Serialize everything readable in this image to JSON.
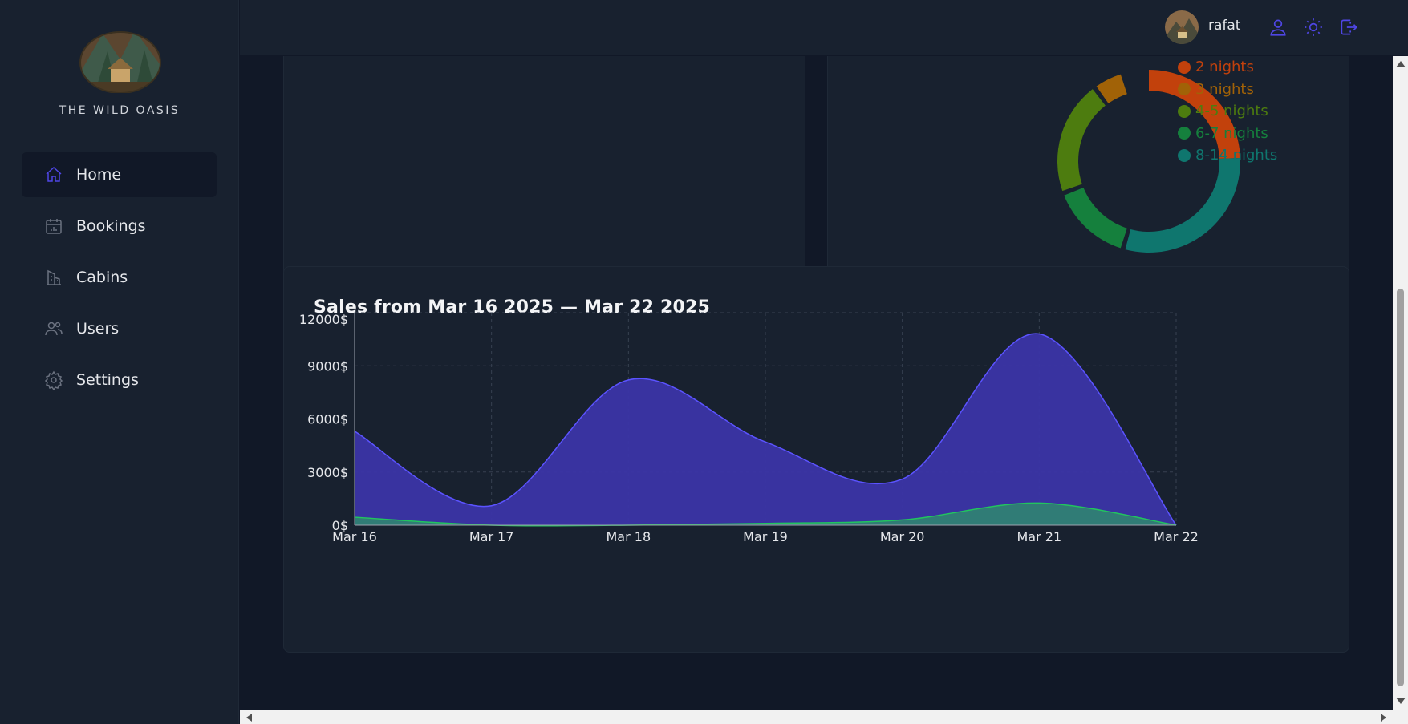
{
  "app": {
    "brand": "THE WILD OASIS"
  },
  "sidebar": {
    "items": [
      {
        "label": "Home",
        "icon": "home-icon",
        "active": true
      },
      {
        "label": "Bookings",
        "icon": "calendar-icon",
        "active": false
      },
      {
        "label": "Cabins",
        "icon": "building-icon",
        "active": false
      },
      {
        "label": "Users",
        "icon": "users-icon",
        "active": false
      },
      {
        "label": "Settings",
        "icon": "gear-icon",
        "active": false
      }
    ]
  },
  "header": {
    "username": "rafat",
    "icons": [
      "user-icon",
      "sun-icon",
      "logout-icon"
    ]
  },
  "colors": {
    "accent": "#4f46e5",
    "bg": "#111827",
    "panel": "#18212f",
    "sales_fill": "#3b35a6",
    "sales_stroke": "#5b53ff",
    "extras_fill": "#2f8a6f",
    "extras_stroke": "#22c55e"
  },
  "durations": {
    "legend": [
      {
        "label": "2 nights",
        "color": "#c2410c"
      },
      {
        "label": "3 nights",
        "color": "#a16207"
      },
      {
        "label": "4-5 nights",
        "color": "#4d7c0f"
      },
      {
        "label": "6-7 nights",
        "color": "#15803d"
      },
      {
        "label": "8-14 nights",
        "color": "#0f766e"
      }
    ]
  },
  "sales": {
    "title": "Sales from Mar 16 2025 — Mar 22 2025"
  },
  "chart_data": {
    "type": "area",
    "title": "Sales from Mar 16 2025 — Mar 22 2025",
    "categories": [
      "Mar 16",
      "Mar 17",
      "Mar 18",
      "Mar 19",
      "Mar 20",
      "Mar 21",
      "Mar 22"
    ],
    "series": [
      {
        "values": [
          5300,
          1100,
          8200,
          4700,
          2600,
          10800,
          0
        ],
        "color": "#3b35a6"
      },
      {
        "values": [
          450,
          0,
          0,
          100,
          300,
          1250,
          0
        ],
        "color": "#2f8a6f"
      }
    ],
    "y_ticks": [
      "0$",
      "3000$",
      "6000$",
      "9000$",
      "12000$"
    ],
    "ylim": [
      0,
      12000
    ],
    "grid": true
  }
}
